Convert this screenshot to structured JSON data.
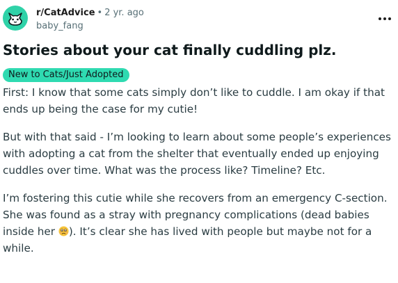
{
  "post": {
    "subreddit": "r/CatAdvice",
    "separator": "•",
    "age": "2 yr. ago",
    "author": "baby_fang",
    "title": "Stories about your cat finally cuddling plz.",
    "flair": "New to Cats/Just Adopted",
    "body": {
      "p1": [
        "First: I know that some cats simply don’t like to cuddle. I am okay if that",
        "ends up being the case for my cutie!"
      ],
      "p2": [
        "But with that said - I’m looking to learn about some people’s experiences",
        "with adopting a cat from the shelter that eventually ended up enjoying",
        "cuddles over time. What was the process like? Timeline? Etc."
      ],
      "p3": [
        "I’m fostering this cutie while she recovers from an emergency C-section.",
        "She was found as a stray with pregnancy complications (dead babies",
        "inside her",
        "). It’s clear she has lived with people but maybe not for a",
        "while."
      ]
    }
  },
  "icons": {
    "avatar": "cat-face-icon",
    "more": "more-horizontal-icon",
    "emoji": "sad-face-emoji-icon"
  },
  "colors": {
    "avatar_bg": "#2fd2a8",
    "flair_bg": "#2fdab1",
    "text": "#1c1c1c",
    "muted": "#576f76"
  }
}
